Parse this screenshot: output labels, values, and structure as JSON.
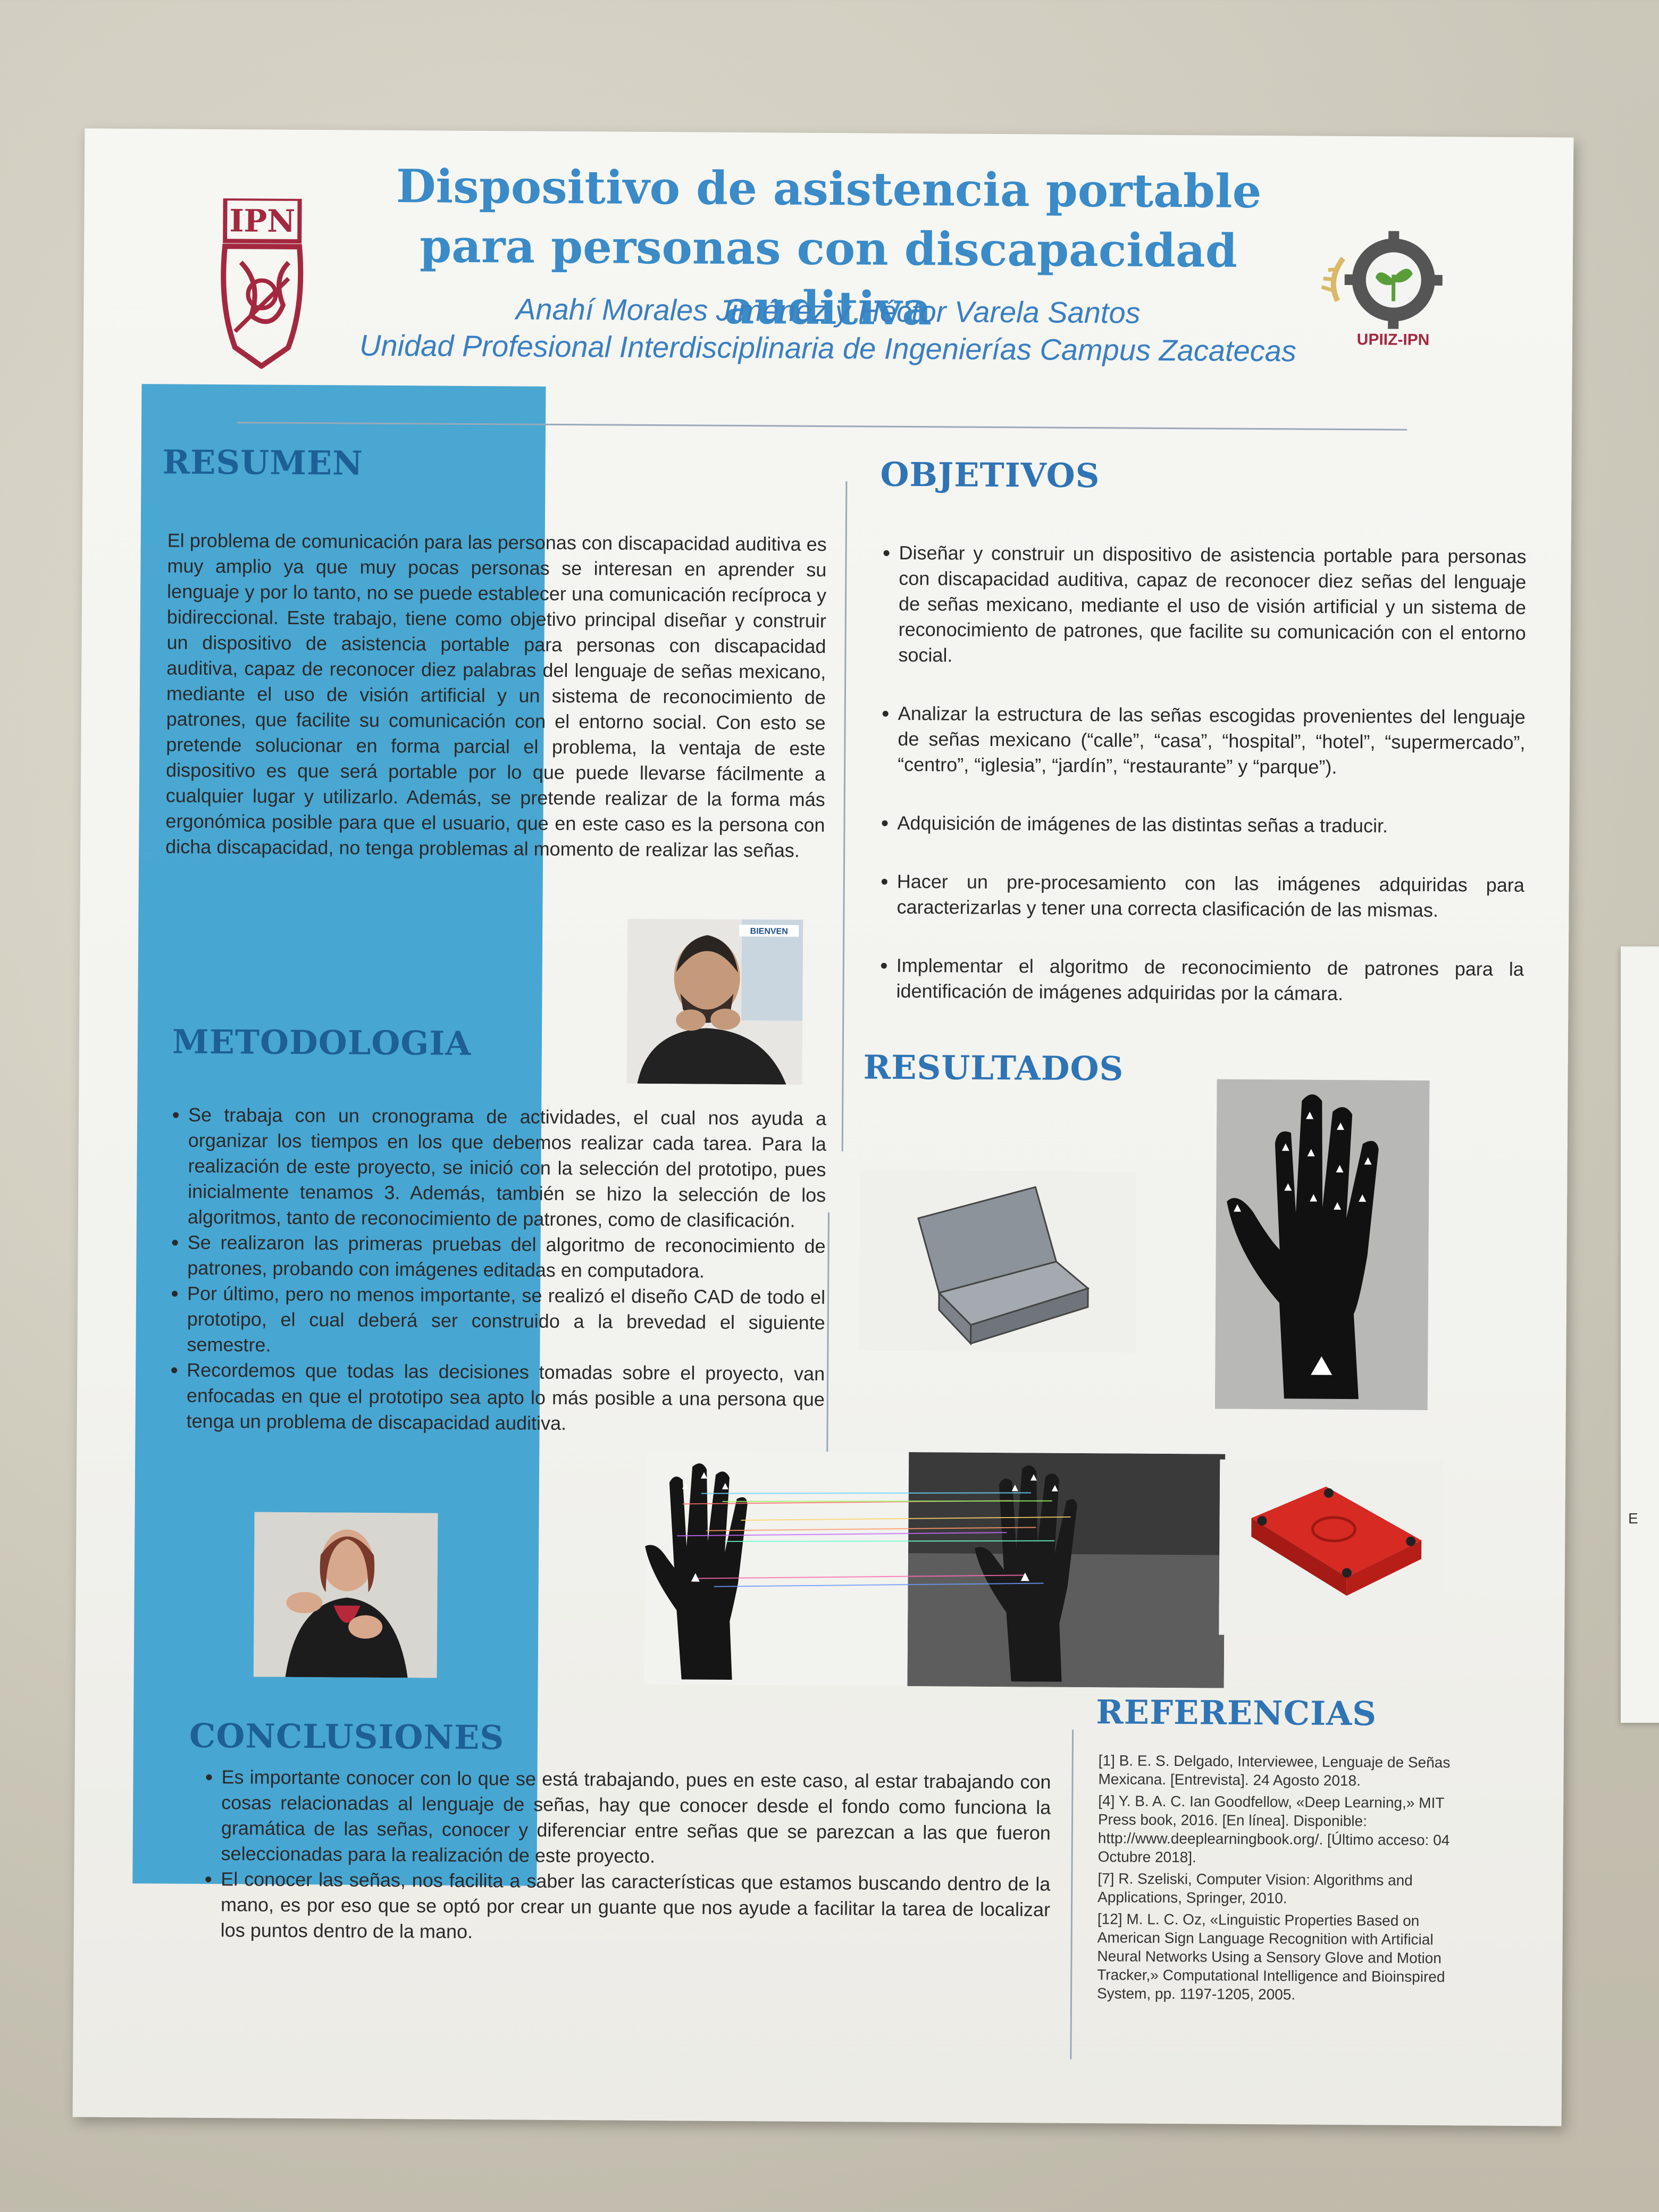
{
  "poster": {
    "title": "Dispositivo de asistencia portable para personas con discapacidad auditiva",
    "authors": "Anahí Morales Jiménez y Héctor Varela Santos",
    "institution": "Unidad Profesional Interdisciplinaria de Ingenierías Campus Zacatecas",
    "logo_left": "IPN",
    "logo_right": "UPIIZ-IPN"
  },
  "resumen": {
    "heading": "RESUMEN",
    "text": "El problema de comunicación para las personas con discapacidad auditiva es muy amplio ya que muy pocas personas se interesan en aprender su lenguaje y por lo tanto, no se puede establecer una comunicación recíproca y bidireccional. Este trabajo, tiene como objetivo principal diseñar y construir un dispositivo de asistencia portable para personas con discapacidad auditiva, capaz de reconocer diez palabras del lenguaje de señas mexicano, mediante el uso de visión artificial y un sistema de reconocimiento de patrones, que facilite su comunicación con el entorno social. Con esto se pretende solucionar en forma parcial el problema, la ventaja de este dispositivo es que será portable por lo que puede llevarse fácilmente a cualquier lugar y utilizarlo. Además, se pretende realizar de la forma más ergonómica posible para que el usuario, que en este caso es la persona con dicha discapacidad, no tenga problemas al momento de realizar las señas."
  },
  "metodologia": {
    "heading": "METODOLOGIA",
    "items": [
      "Se trabaja con un cronograma de actividades, el cual nos ayuda a organizar los tiempos en los que debemos realizar cada tarea. Para la realización de este proyecto, se inició con la selección del prototipo, pues inicialmente tenamos 3. Además, también se hizo la selección de los algoritmos, tanto de reconocimiento de patrones, como de clasificación.",
      "Se realizaron las primeras pruebas del algoritmo de reconocimiento de patrones, probando con imágenes editadas en computadora.",
      "Por último, pero no menos importante, se realizó el diseño CAD de todo el prototipo, el cual deberá ser construido a la brevedad el siguiente semestre.",
      "Recordemos que todas las decisiones tomadas sobre el proyecto, van enfocadas en que el prototipo sea apto lo más posible a una persona que tenga un problema de discapacidad auditiva."
    ]
  },
  "objetivos": {
    "heading": "OBJETIVOS",
    "items": [
      "Diseñar y construir un dispositivo de asistencia portable para personas con discapacidad auditiva, capaz de reconocer diez señas del lenguaje de señas mexicano, mediante el uso de visión artificial y un sistema de reconocimiento de patrones, que facilite su comunicación con el entorno social.",
      "Analizar la estructura de las señas escogidas provenientes del lenguaje de señas mexicano (“calle”, “casa”, “hospital”, “hotel”, “supermercado”, “centro”, “iglesia”, “jardín”, “restaurante” y “parque”).",
      "Adquisición de imágenes de las distintas señas a traducir.",
      "Hacer un pre-procesamiento con las imágenes adquiridas para caracterizarlas y tener una correcta clasificación de las mismas.",
      "Implementar el algoritmo de reconocimiento de patrones para la identificación de imágenes adquiridas por la cámara."
    ]
  },
  "resultados": {
    "heading": "RESULTADOS"
  },
  "conclusiones": {
    "heading": "CONCLUSIONES",
    "items": [
      "Es importante conocer con lo que se está trabajando, pues en este caso, al estar trabajando con cosas relacionadas al lenguaje de señas, hay que conocer desde el fondo como funciona la gramática de las señas, conocer y diferenciar entre señas que se parezcan a las que fueron seleccionadas para la realización de este proyecto.",
      "El conocer las señas, nos facilita a saber las características que estamos buscando dentro de la mano, es por eso que se optó por crear un guante que nos ayude a facilitar la tarea de localizar los puntos dentro de la mano."
    ]
  },
  "referencias": {
    "heading": "REFERENCIAS",
    "items": [
      "[1]      B. E. S. Delgado, Interviewee, Lenguaje de Señas Mexicana. [Entrevista]. 24 Agosto 2018.",
      "[4]      Y. B. A. C. Ian Goodfellow, «Deep Learning,» MIT Press book, 2016. [En línea]. Disponible: http://www.deeplearningbook.org/. [Último acceso: 04 Octubre 2018].",
      "[7]      R. Szeliski, Computer Vision: Algorithms and Applications, Springer, 2010.",
      "[12]    M. L. C. Oz, «Linguistic Properties Based on American Sign Language Recognition with Artificial Neural Networks Using a Sensory Glove and Motion Tracker,» Computational Intelligence and Bioinspired System, pp. 1197-1205, 2005."
    ]
  },
  "colors": {
    "heading_blue": "#2f74b5",
    "panel_blue": "#3aa0cf",
    "logo_red": "#a3283f"
  },
  "photos": {
    "screen_text": "BIENVEN"
  }
}
